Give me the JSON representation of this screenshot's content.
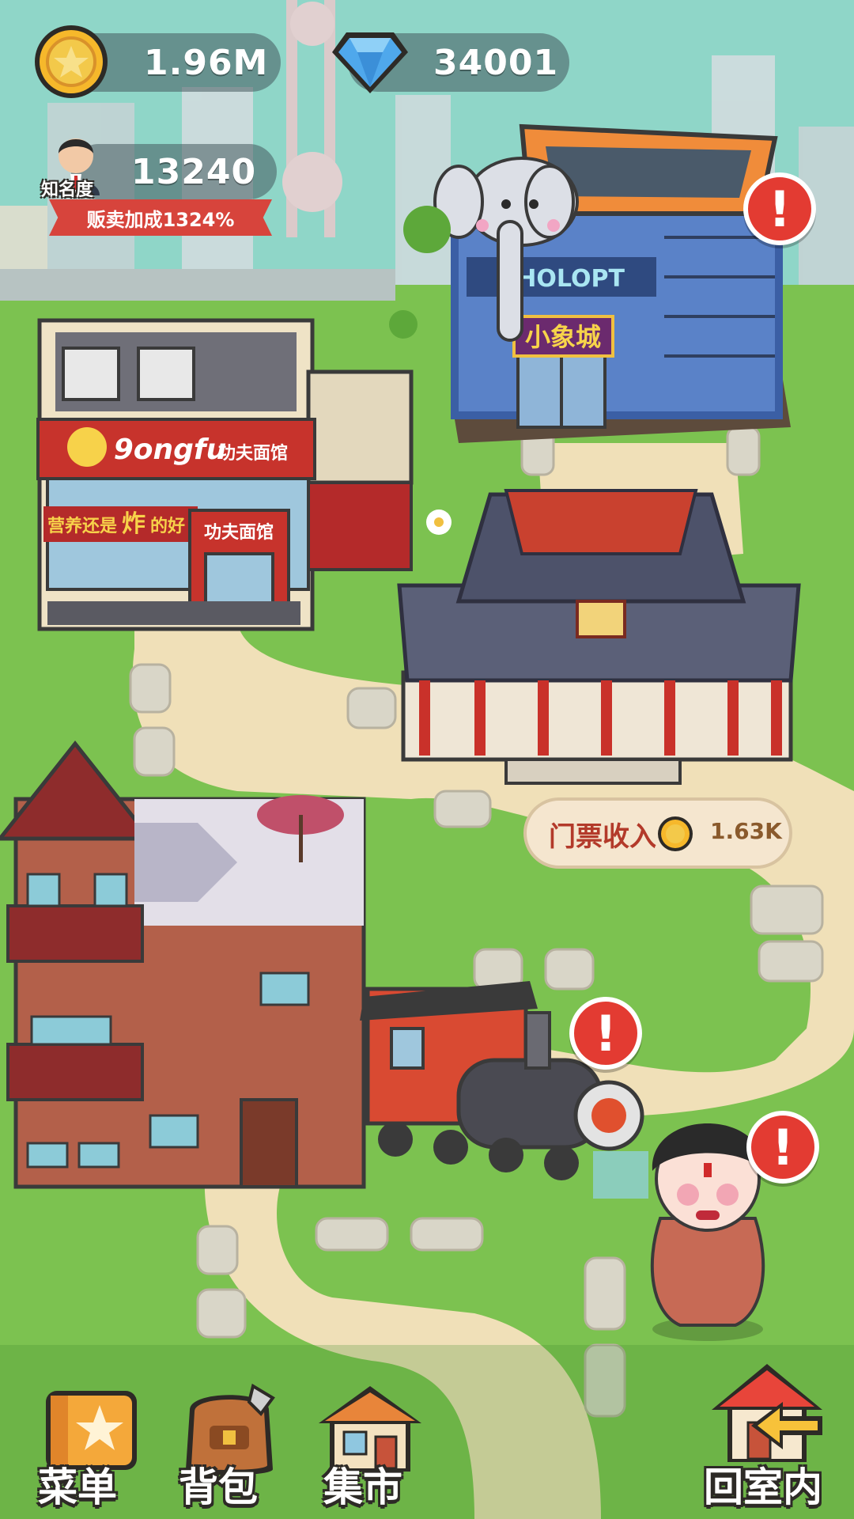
{
  "hud": {
    "coins": "1.96M",
    "gems": "34001",
    "fame_label": "知名度",
    "fame_value": "13240",
    "sell_bonus": "贩卖加成1324%"
  },
  "buildings": {
    "mall_sign": "小象城",
    "mall_facade": "AHOLOPT",
    "kungfu_logo": "9ongfu",
    "kungfu_sign_1": "功夫面馆",
    "kungfu_sign_2": "功夫面馆",
    "kungfu_banner_pre": "营养还是",
    "kungfu_banner_big": "炸",
    "kungfu_banner_post": "的好"
  },
  "ticket": {
    "label": "门票收入",
    "value": "1.63K"
  },
  "alerts": {
    "glyph": "!"
  },
  "bottom_bar": {
    "menu": "菜单",
    "bag": "背包",
    "market": "集市",
    "back_indoor": "回室内"
  },
  "colors": {
    "sky": "#8fd6c8",
    "grass": "#7cc250",
    "path": "#f0e0b8",
    "alert": "#e33b32",
    "ribbon": "#d7443c"
  }
}
